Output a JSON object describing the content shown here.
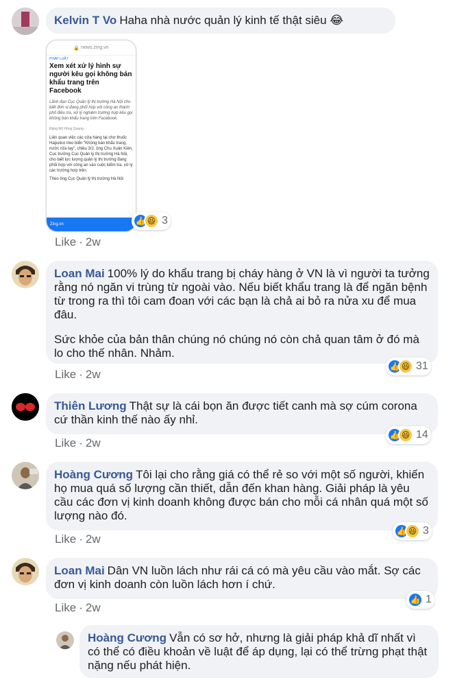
{
  "comments": [
    {
      "author": "Kelvin T Vo",
      "text": "Haha nhà nước quản lý kinh tế thật siêu 😂",
      "like": "Like",
      "time": "2w",
      "react_count": "3"
    },
    {
      "author": "Loan Mai",
      "text": "100% lý do khẩu trang bị cháy hàng ở VN là vì người ta tưởng rằng nó ngăn vi trùng từ ngoài vào. Nếu biết khẩu trang là để ngăn bệnh từ trong ra thì tôi cam đoan với các bạn là chả ai bỏ ra nửa xu để mua đâu.",
      "text2": "Sức khỏe của bản thân chúng nó chúng nó còn chả quan tâm ở đó mà lo cho thế nhân. Nhảm.",
      "like": "Like",
      "time": "2w",
      "react_count": "31"
    },
    {
      "author": "Thiên Lương",
      "text": "Thật sự là cái bọn ăn được tiết canh mà sợ cúm corona cứ thần kinh thế nào ấy nhỉ.",
      "like": "Like",
      "time": "2w",
      "react_count": "14"
    },
    {
      "author": "Hoàng Cương",
      "text": "Tôi lại cho rằng giá có thể rẻ so với một số người, khiến họ mua quá số lượng cần thiết, dẫn đến khan hàng. Giải pháp là yêu cầu các đơn vị kinh doanh không được bán cho mỗi cá nhân quá một số lượng nào đó.",
      "like": "Like",
      "time": "2w",
      "react_count": "3"
    },
    {
      "author": "Loan Mai",
      "text": "Dân VN luồn lách như rái cá có mà yêu cầu vào mắt. Sợ các đơn vị kinh doanh còn luồn lách hơn í chứ.",
      "like": "Like",
      "time": "2w",
      "react_count": "1"
    },
    {
      "author": "Hoàng Cương",
      "text": "Vẫn có sơ hở, nhưng là giải pháp khả dĩ nhất vì có thể có điều khoản về luật để áp dụng, lại có thể trừng phạt thật nặng nếu phát hiện."
    }
  ],
  "screenshot": {
    "url": "news.zing.vn",
    "section": "PHÁP LUẬT",
    "headline": "Xem xét xử lý hình sự người kêu gọi không bán khẩu trang trên Facebook",
    "lead": "Lãnh đạo Cục Quản lý thị trường Hà Nội cho biết đơn vị đang phối hợp với công an thành phố điều tra, xử lý nghiêm trường hợp kêu gọi không bán khẩu trang trên Facebook.",
    "byline": "Đặng Mỹ Hồng Quang",
    "body": "Liên quan việc các cửa hàng tại chợ thuốc Hapulico treo biển \"Không bán khẩu trang, nước rửa tay\", chiều 3/2, ông Chu Xuân Kiên, Cục trưởng Cục Quản lý thị trường Hà Nội, cho biết lực lượng quản lý thị trường đang phối hợp với công an vào cuộc kiểm tra, xử lý các trường hợp trên.",
    "body2": "Theo ông Cục Quản lý thị trường Hà Nội",
    "footer_brand": "Zing.vn"
  },
  "colors": {
    "author": "#385898",
    "bubble": "#f0f2f5",
    "meta": "#65676b",
    "like_blue": "#1877f2",
    "haha_yellow": "#f7c744"
  }
}
